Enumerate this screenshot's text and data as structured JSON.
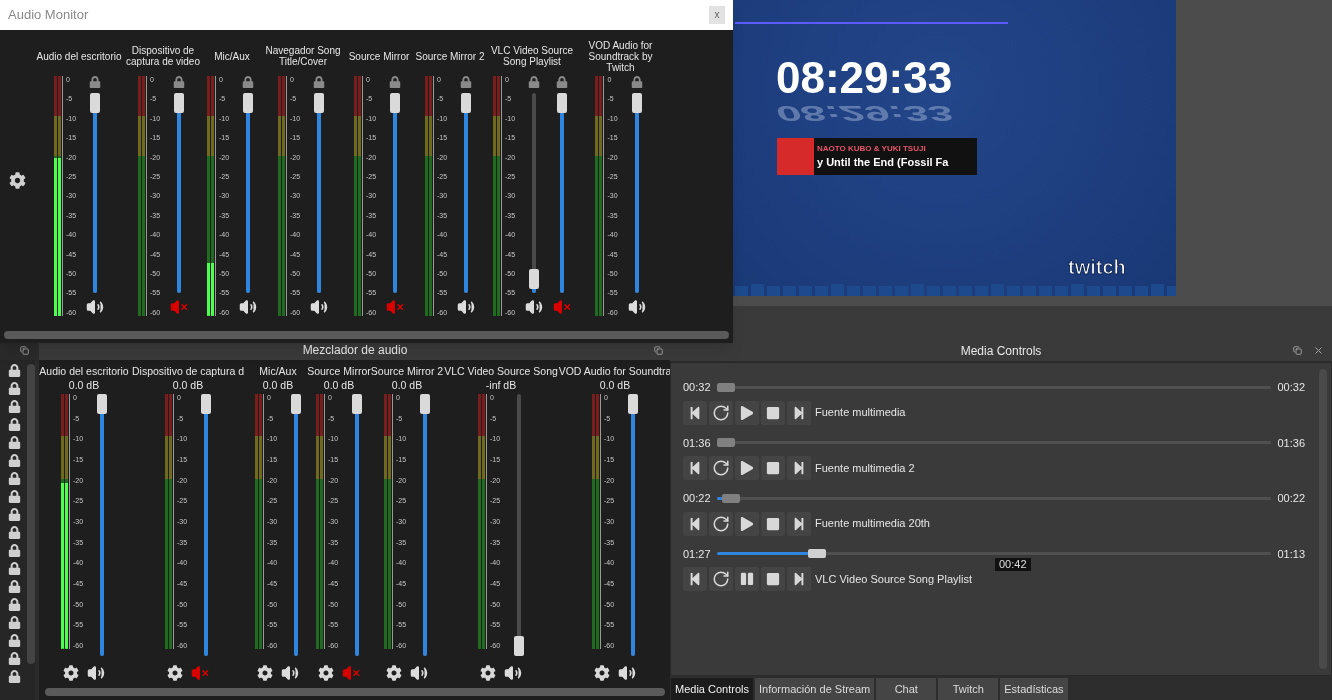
{
  "preview": {
    "clock": "08:29:33",
    "clock_reflection": "08:29:33",
    "now_playing": {
      "artist": "NAOTO KUBO & YUKI TSUJI",
      "title": "y Until the End (Fossil Fa"
    },
    "logo": "twitch"
  },
  "audio_monitor": {
    "title": "Audio Monitor",
    "close": "x",
    "channels": [
      {
        "name": "Audio del escritorio",
        "meter": {
          "level": 0.66,
          "scale": [
            "0",
            "-5",
            "-10",
            "-15",
            "-20",
            "-25",
            "-30",
            "-35",
            "-40",
            "-45",
            "-50",
            "-55",
            "-60"
          ]
        },
        "sliders": [
          {
            "level": 1,
            "muted": false
          }
        ]
      },
      {
        "name": "Dispositivo de captura de video",
        "meter": {
          "level": 0,
          "scale": [
            "0",
            "-5",
            "-10",
            "-15",
            "-20",
            "-25",
            "-30",
            "-35",
            "-40",
            "-45",
            "-50",
            "-55",
            "-60"
          ]
        },
        "sliders": [
          {
            "level": 1,
            "muted": true
          }
        ]
      },
      {
        "name": "Mic/Aux",
        "meter": {
          "level": 0.22,
          "scale": [
            "0",
            "-5",
            "-10",
            "-15",
            "-20",
            "-25",
            "-30",
            "-35",
            "-40",
            "-45",
            "-50",
            "-55",
            "-60"
          ]
        },
        "sliders": [
          {
            "level": 1,
            "muted": false
          }
        ]
      },
      {
        "name": "Navegador Song Title/Cover",
        "meter": {
          "level": 0,
          "scale": [
            "0",
            "-5",
            "-10",
            "-15",
            "-20",
            "-25",
            "-30",
            "-35",
            "-40",
            "-45",
            "-50",
            "-55",
            "-60"
          ]
        },
        "sliders": [
          {
            "level": 1,
            "muted": false
          }
        ]
      },
      {
        "name": "Source Mirror",
        "meter": {
          "level": 0,
          "scale": [
            "0",
            "-5",
            "-10",
            "-15",
            "-20",
            "-25",
            "-30",
            "-35",
            "-40",
            "-45",
            "-50",
            "-55",
            "-60"
          ]
        },
        "sliders": [
          {
            "level": 1,
            "muted": true
          }
        ]
      },
      {
        "name": "Source Mirror 2",
        "meter": {
          "level": 0,
          "scale": [
            "0",
            "-5",
            "-10",
            "-15",
            "-20",
            "-25",
            "-30",
            "-35",
            "-40",
            "-45",
            "-50",
            "-55",
            "-60"
          ]
        },
        "sliders": [
          {
            "level": 1,
            "muted": false
          }
        ]
      },
      {
        "name": "VLC Video Source Song Playlist",
        "meter": {
          "level": 0,
          "scale": [
            "0",
            "-5",
            "-10",
            "-15",
            "-20",
            "-25",
            "-30",
            "-35",
            "-40",
            "-45",
            "-50",
            "-55",
            "-60"
          ]
        },
        "sliders": [
          {
            "level": 0.02,
            "muted": false
          },
          {
            "level": 1,
            "muted": true
          }
        ]
      },
      {
        "name": "VOD Audio for Soundtrack by Twitch",
        "meter": {
          "level": 0,
          "scale": [
            "0",
            "-5",
            "-10",
            "-15",
            "-20",
            "-25",
            "-30",
            "-35",
            "-40",
            "-45",
            "-50",
            "-55",
            "-60"
          ]
        },
        "sliders": [
          {
            "level": 1,
            "muted": false
          }
        ]
      }
    ]
  },
  "mixer": {
    "title": "Mezclador de audio",
    "channels": [
      {
        "name": "Audio del escritorio",
        "db": "0.0 dB",
        "meter": {
          "level": 0.65,
          "scale": [
            "0",
            "-5",
            "-10",
            "-15",
            "-20",
            "-25",
            "-30",
            "-35",
            "-40",
            "-45",
            "-50",
            "-55",
            "-60"
          ]
        },
        "volume": {
          "level": 1
        },
        "muted": false
      },
      {
        "name": "Dispositivo de captura d",
        "db": "0.0 dB",
        "meter": {
          "level": 0,
          "scale": [
            "0",
            "-5",
            "-10",
            "-15",
            "-20",
            "-25",
            "-30",
            "-35",
            "-40",
            "-45",
            "-50",
            "-55",
            "-60"
          ]
        },
        "volume": {
          "level": 1
        },
        "muted": true
      },
      {
        "name": "Mic/Aux",
        "db": "0.0 dB",
        "meter": {
          "level": 0,
          "scale": [
            "0",
            "-5",
            "-10",
            "-15",
            "-20",
            "-25",
            "-30",
            "-35",
            "-40",
            "-45",
            "-50",
            "-55",
            "-60"
          ]
        },
        "volume": {
          "level": 1
        },
        "muted": false
      },
      {
        "name": "Source Mirror",
        "db": "0.0 dB",
        "meter": {
          "level": 0,
          "scale": [
            "0",
            "-5",
            "-10",
            "-15",
            "-20",
            "-25",
            "-30",
            "-35",
            "-40",
            "-45",
            "-50",
            "-55",
            "-60"
          ]
        },
        "volume": {
          "level": 1
        },
        "muted": true
      },
      {
        "name": "Source Mirror 2",
        "db": "0.0 dB",
        "meter": {
          "level": 0,
          "scale": [
            "0",
            "-5",
            "-10",
            "-15",
            "-20",
            "-25",
            "-30",
            "-35",
            "-40",
            "-45",
            "-50",
            "-55",
            "-60"
          ]
        },
        "volume": {
          "level": 1
        },
        "muted": false
      },
      {
        "name": "VLC Video Source Song",
        "db": "-inf dB",
        "meter": {
          "level": 0,
          "scale": [
            "0",
            "-5",
            "-10",
            "-15",
            "-20",
            "-25",
            "-30",
            "-35",
            "-40",
            "-45",
            "-50",
            "-55",
            "-60"
          ]
        },
        "volume": {
          "level": 0
        },
        "muted": false
      },
      {
        "name": "VOD Audio for Soundtra",
        "db": "0.0 dB",
        "meter": {
          "level": 0,
          "scale": [
            "0",
            "-5",
            "-10",
            "-15",
            "-20",
            "-25",
            "-30",
            "-35",
            "-40",
            "-45",
            "-50",
            "-55",
            "-60"
          ]
        },
        "volume": {
          "level": 1
        },
        "muted": false
      }
    ]
  },
  "media_controls": {
    "title": "Media Controls",
    "items": [
      {
        "start": "00:32",
        "end": "00:32",
        "level": 0,
        "name": "Fuente multimedia",
        "playing": false
      },
      {
        "start": "01:36",
        "end": "01:36",
        "level": 0,
        "name": "Fuente multimedia 2",
        "playing": false
      },
      {
        "start": "00:22",
        "end": "00:22",
        "level": 0.01,
        "name": "Fuente multimedia 20th",
        "playing": false
      },
      {
        "start": "01:27",
        "end": "01:13",
        "level": 0.17,
        "name": "VLC Video Source Song Playlist",
        "playing": true,
        "tooltip": "00:42"
      }
    ]
  },
  "dock_tabs": [
    {
      "label": "Media Controls",
      "selected": true
    },
    {
      "label": "Información de Stream",
      "selected": false
    },
    {
      "label": "Chat",
      "selected": false
    },
    {
      "label": "Twitch",
      "selected": false
    },
    {
      "label": "Estadísticas",
      "selected": false
    }
  ]
}
